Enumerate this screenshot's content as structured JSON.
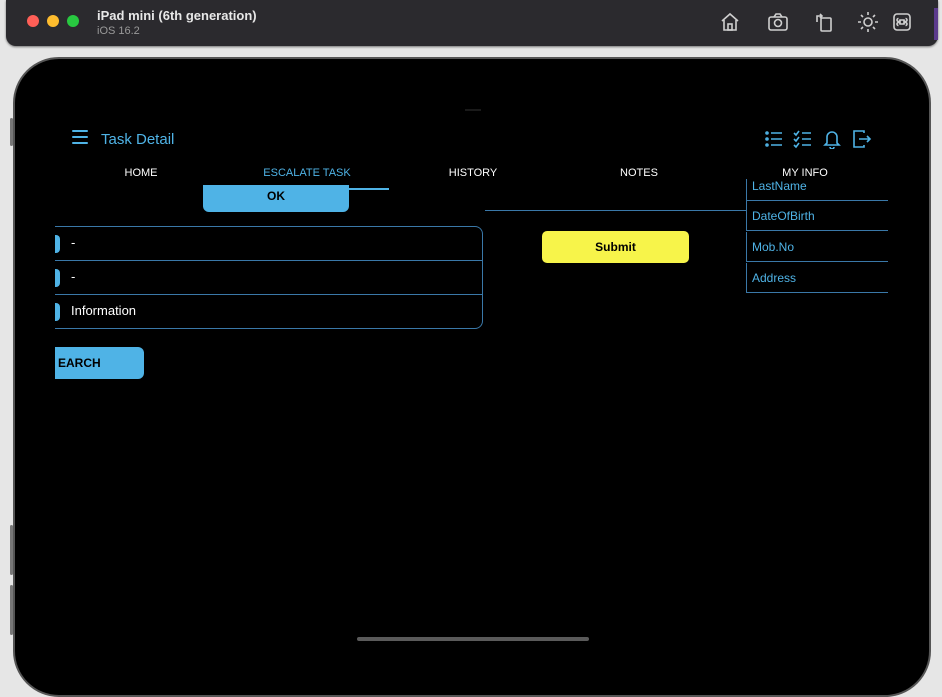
{
  "simulator": {
    "device_name": "iPad mini (6th generation)",
    "os_version": "iOS 16.2",
    "toolbar_icons": [
      "home-icon",
      "screenshot-icon",
      "rotate-icon",
      "brightness-icon",
      "command-icon"
    ]
  },
  "app": {
    "title": "Task  Detail",
    "header_icons": [
      "list-icon",
      "checklist-icon",
      "bell-icon",
      "logout-icon"
    ],
    "tabs": [
      {
        "label": "HOME",
        "active": false
      },
      {
        "label": "ESCALATE TASK",
        "active": true
      },
      {
        "label": "HISTORY",
        "active": false
      },
      {
        "label": "NOTES",
        "active": false
      },
      {
        "label": "MY INFO",
        "active": false
      }
    ],
    "ok_label": "OK",
    "list_rows": [
      "-",
      "-",
      "Information"
    ],
    "search_label": "EARCH",
    "submit_label": "Submit",
    "info_items": [
      "LastName",
      "DateOfBirth",
      "Mob.No",
      "Address"
    ]
  },
  "colors": {
    "accent": "#4fb3e6",
    "submit": "#f7f44a",
    "background": "#000000",
    "border": "#3a78a8"
  }
}
